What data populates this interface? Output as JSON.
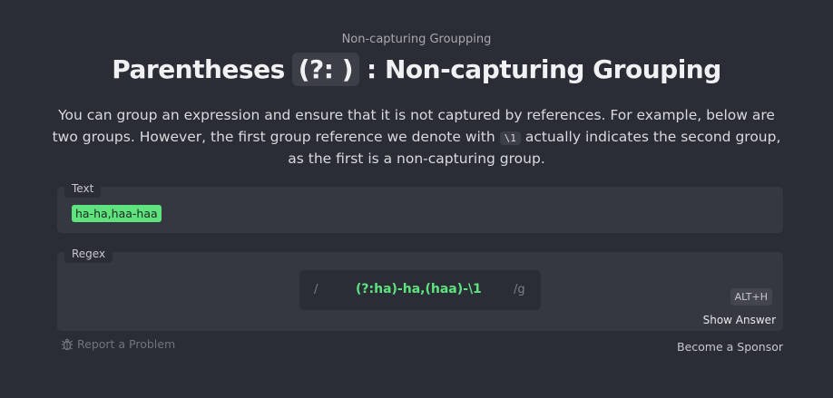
{
  "header": {
    "subtitle": "Non-capturing Groupping",
    "title_prefix": "Parentheses",
    "title_code": "(?: )",
    "title_suffix": ": Non-capturing Grouping"
  },
  "description": {
    "part1": "You can group an expression and ensure that it is not captured by references. For example, below are two groups. However, the first group reference we denote with",
    "inline_code": "\\1",
    "part2": "actually indicates the second group, as the first is a non-capturing group."
  },
  "text_panel": {
    "label": "Text",
    "match": "ha-ha,haa-haa"
  },
  "regex_panel": {
    "label": "Regex",
    "slash": "/",
    "value": "(?:ha)-ha,(haa)-\\1",
    "flags": "/g",
    "shortcut": "ALT+H",
    "show_answer": "Show Answer"
  },
  "footer": {
    "report": "Report a Problem",
    "report_icon": "bug-icon",
    "sponsor": "Become a Sponsor"
  },
  "colors": {
    "background": "#2b2d36",
    "panel": "#363841",
    "accent_green": "#5ee37f"
  }
}
